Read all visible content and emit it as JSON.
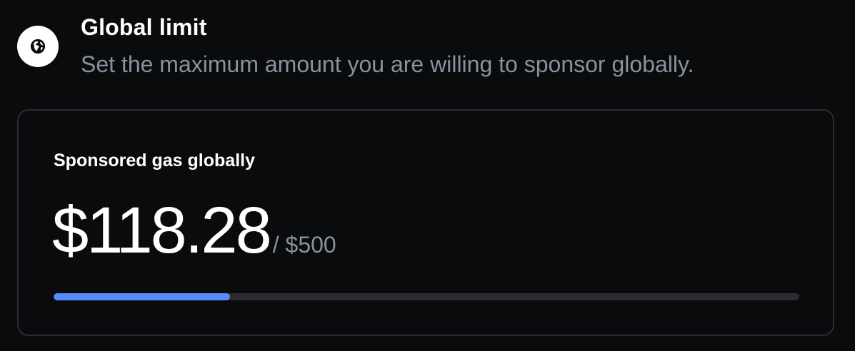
{
  "header": {
    "icon": "globe-icon",
    "title": "Global limit",
    "subtitle": "Set the maximum amount you are willing to sponsor globally."
  },
  "card": {
    "label": "Sponsored gas globally",
    "amount": "$118.28",
    "limit": "/ $500",
    "progress_fraction": 0.2366
  },
  "colors": {
    "background": "#0a0b0d",
    "text_primary": "#ffffff",
    "text_secondary": "#8a919e",
    "card_border": "#2a2c31",
    "progress_track": "#2a2c31",
    "progress_fill": "#578bfa"
  }
}
